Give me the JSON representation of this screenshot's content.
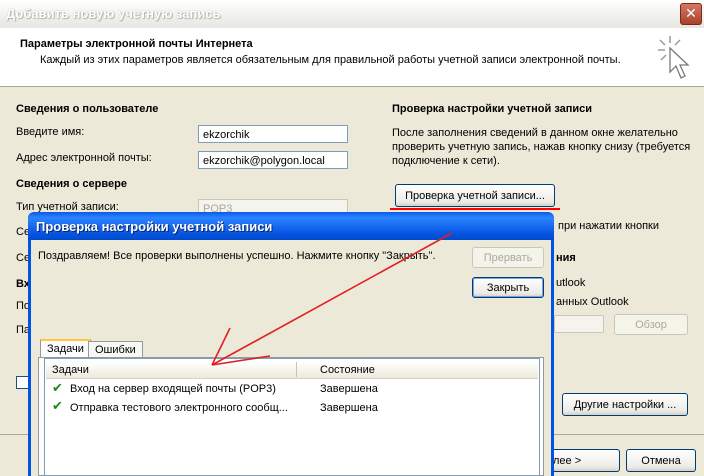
{
  "window": {
    "title": "Добавить новую учетную запись",
    "close_glyph": "✕"
  },
  "header": {
    "title": "Параметры электронной почты Интернета",
    "subtitle": "Каждый из этих параметров является обязательным для правильной работы учетной записи электронной почты."
  },
  "user_info": {
    "section_title": "Сведения о пользователе",
    "name_label": "Введите имя:",
    "name_value": "ekzorchik",
    "email_label": "Адрес электронной почты:",
    "email_value": "ekzorchik@polygon.local"
  },
  "server_info": {
    "section_title": "Сведения о сервере",
    "account_type_label": "Тип учетной записи:",
    "account_type_value": "POP3",
    "hidden_labels": [
      "Се",
      "Се",
      "Вх",
      "По",
      "Па"
    ]
  },
  "verify": {
    "section_title": "Проверка настройки учетной записи",
    "description": "После заполнения сведений в данном окне желательно проверить учетную запись, нажав кнопку снизу (требуется подключение к сети).",
    "button_label": "Проверка учетной записи...",
    "partial_text_1": "при нажатии кнопки",
    "partial_text_2": "ния",
    "partial_text_3": "utlook",
    "partial_text_4": "анных Outlook",
    "browse_button": "Обзор",
    "other_settings_button": "Другие настройки ..."
  },
  "footer": {
    "next_button": "лее >",
    "cancel_button": "Отмена"
  },
  "dialog": {
    "title": "Проверка настройки учетной записи",
    "message": "Поздравляем! Все проверки выполнены успешно. Нажмите кнопку \"Закрыть\".",
    "stop_button": "Прервать",
    "close_button": "Закрыть",
    "tabs": [
      {
        "label": "Задачи",
        "active": true
      },
      {
        "label": "Ошибки",
        "active": false
      }
    ],
    "columns": [
      "Задачи",
      "Состояние"
    ],
    "rows": [
      {
        "task": "Вход на сервер входящей почты (POP3)",
        "status": "Завершена",
        "icon": "check-icon"
      },
      {
        "task": "Отправка тестового электронного сообщ...",
        "status": "Завершена",
        "icon": "check-icon"
      }
    ]
  },
  "colors": {
    "accent_line": "#ff0000",
    "arrow": "#e02020",
    "dialog_title": "#0a5ae6"
  }
}
